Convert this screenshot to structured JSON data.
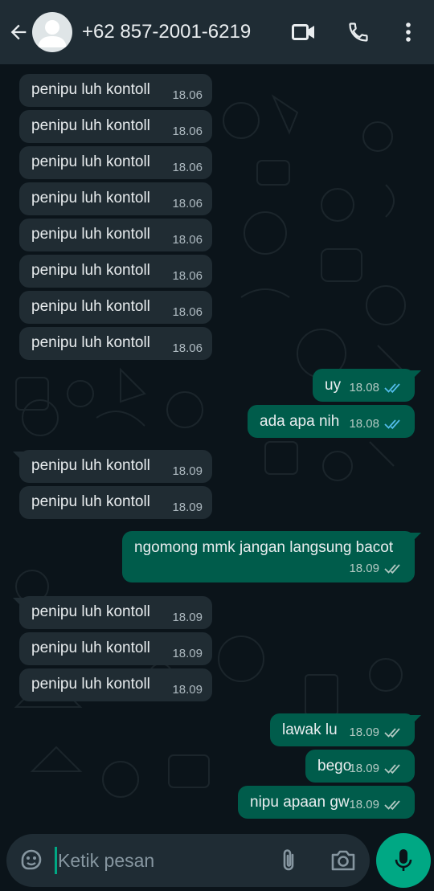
{
  "header": {
    "contact_name": "+62 857-2001-6219",
    "icons": [
      "back-arrow-icon",
      "avatar-icon",
      "video-call-icon",
      "phone-icon",
      "more-vert-icon"
    ]
  },
  "messages": [
    {
      "dir": "in",
      "text": "penipu luh kontoll",
      "time": "18.06"
    },
    {
      "dir": "in",
      "text": "penipu luh kontoll",
      "time": "18.06"
    },
    {
      "dir": "in",
      "text": "penipu luh kontoll",
      "time": "18.06"
    },
    {
      "dir": "in",
      "text": "penipu luh kontoll",
      "time": "18.06"
    },
    {
      "dir": "in",
      "text": "penipu luh kontoll",
      "time": "18.06"
    },
    {
      "dir": "in",
      "text": "penipu luh kontoll",
      "time": "18.06"
    },
    {
      "dir": "in",
      "text": "penipu luh kontoll",
      "time": "18.06"
    },
    {
      "dir": "in",
      "text": "penipu luh kontoll",
      "time": "18.06"
    },
    {
      "dir": "out",
      "text": "uy",
      "time": "18.08",
      "status": "read"
    },
    {
      "dir": "out",
      "text": "ada apa nih",
      "time": "18.08",
      "status": "read"
    },
    {
      "dir": "in",
      "text": "penipu luh kontoll",
      "time": "18.09"
    },
    {
      "dir": "in",
      "text": "penipu luh kontoll",
      "time": "18.09"
    },
    {
      "dir": "out",
      "text": "ngomong mmk jangan langsung bacot",
      "time": "18.09",
      "status": "delivered"
    },
    {
      "dir": "in",
      "text": "penipu luh kontoll",
      "time": "18.09"
    },
    {
      "dir": "in",
      "text": "penipu luh kontoll",
      "time": "18.09"
    },
    {
      "dir": "in",
      "text": "penipu luh kontoll",
      "time": "18.09"
    },
    {
      "dir": "out",
      "text": "lawak lu",
      "time": "18.09",
      "status": "delivered"
    },
    {
      "dir": "out",
      "text": "bego",
      "time": "18.09",
      "status": "delivered"
    },
    {
      "dir": "out",
      "text": "nipu apaan gw",
      "time": "18.09",
      "status": "delivered"
    }
  ],
  "composer": {
    "placeholder": "Ketik pesan",
    "icons": [
      "sticker-icon",
      "attach-icon",
      "camera-icon",
      "mic-icon"
    ]
  },
  "colors": {
    "header_bg": "#1f2c34",
    "chat_bg": "#0b141a",
    "incoming_bubble": "#202c33",
    "outgoing_bubble": "#005c4b",
    "read_tick": "#53bdeb",
    "accent": "#00a884"
  }
}
